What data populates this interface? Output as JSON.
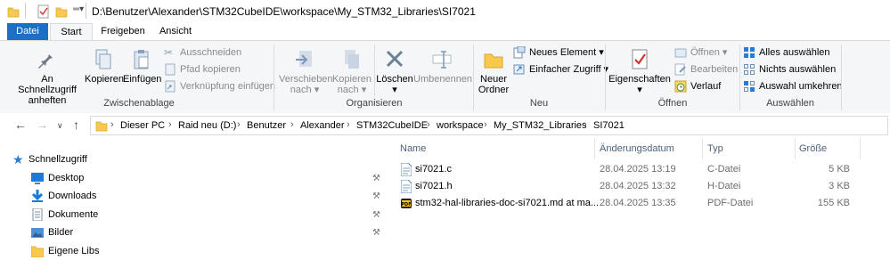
{
  "window": {
    "path": "D:\\Benutzer\\Alexander\\STM32CubeIDE\\workspace\\My_STM32_Libraries\\SI7021"
  },
  "tabs": [
    "Datei",
    "Start",
    "Freigeben",
    "Ansicht"
  ],
  "ribbon": {
    "clipboard": {
      "pin_label_1": "An Schnellzugriff",
      "pin_label_2": "anheften",
      "copy": "Kopieren",
      "paste": "Einfügen",
      "cut": "Ausschneiden",
      "copy_path": "Pfad kopieren",
      "paste_shortcut": "Verknüpfung einfügen",
      "group": "Zwischenablage"
    },
    "organize": {
      "move_1": "Verschieben",
      "move_2": "nach ▾",
      "copyto_1": "Kopieren",
      "copyto_2": "nach ▾",
      "delete": "Löschen",
      "delete_arrow": "▾",
      "rename": "Umbenennen",
      "group": "Organisieren"
    },
    "new": {
      "new_folder_1": "Neuer",
      "new_folder_2": "Ordner",
      "new_item": "Neues Element ▾",
      "easy_access": "Einfacher Zugriff ▾",
      "group": "Neu"
    },
    "open": {
      "properties": "Eigenschaften",
      "properties_arrow": "▾",
      "open": "Öffnen ▾",
      "edit": "Bearbeiten",
      "history": "Verlauf",
      "group": "Öffnen"
    },
    "select": {
      "select_all": "Alles auswählen",
      "select_none": "Nichts auswählen",
      "invert": "Auswahl umkehren",
      "group": "Auswählen"
    }
  },
  "breadcrumb": [
    "Dieser PC",
    "Raid neu (D:)",
    "Benutzer",
    "Alexander",
    "STM32CubeIDE",
    "workspace",
    "My_STM32_Libraries",
    "SI7021"
  ],
  "nav": {
    "quick_access": "Schnellzugriff",
    "items": [
      "Desktop",
      "Downloads",
      "Dokumente",
      "Bilder",
      "Eigene Libs"
    ]
  },
  "columns": {
    "name": "Name",
    "date": "Änderungsdatum",
    "type": "Typ",
    "size": "Größe"
  },
  "files": [
    {
      "name": "si7021.c",
      "date": "28.04.2025 13:19",
      "type": "C-Datei",
      "size": "5 KB"
    },
    {
      "name": "si7021.h",
      "date": "28.04.2025 13:32",
      "type": "H-Datei",
      "size": "3 KB"
    },
    {
      "name": "stm32-hal-libraries-doc-si7021.md at ma...",
      "date": "28.04.2025 13:35",
      "type": "PDF-Datei",
      "size": "155 KB"
    }
  ],
  "colors": {
    "file_tab": "#1c6fc4",
    "folder": "#f8c94c",
    "accent_blue": "#2b7bd4"
  }
}
